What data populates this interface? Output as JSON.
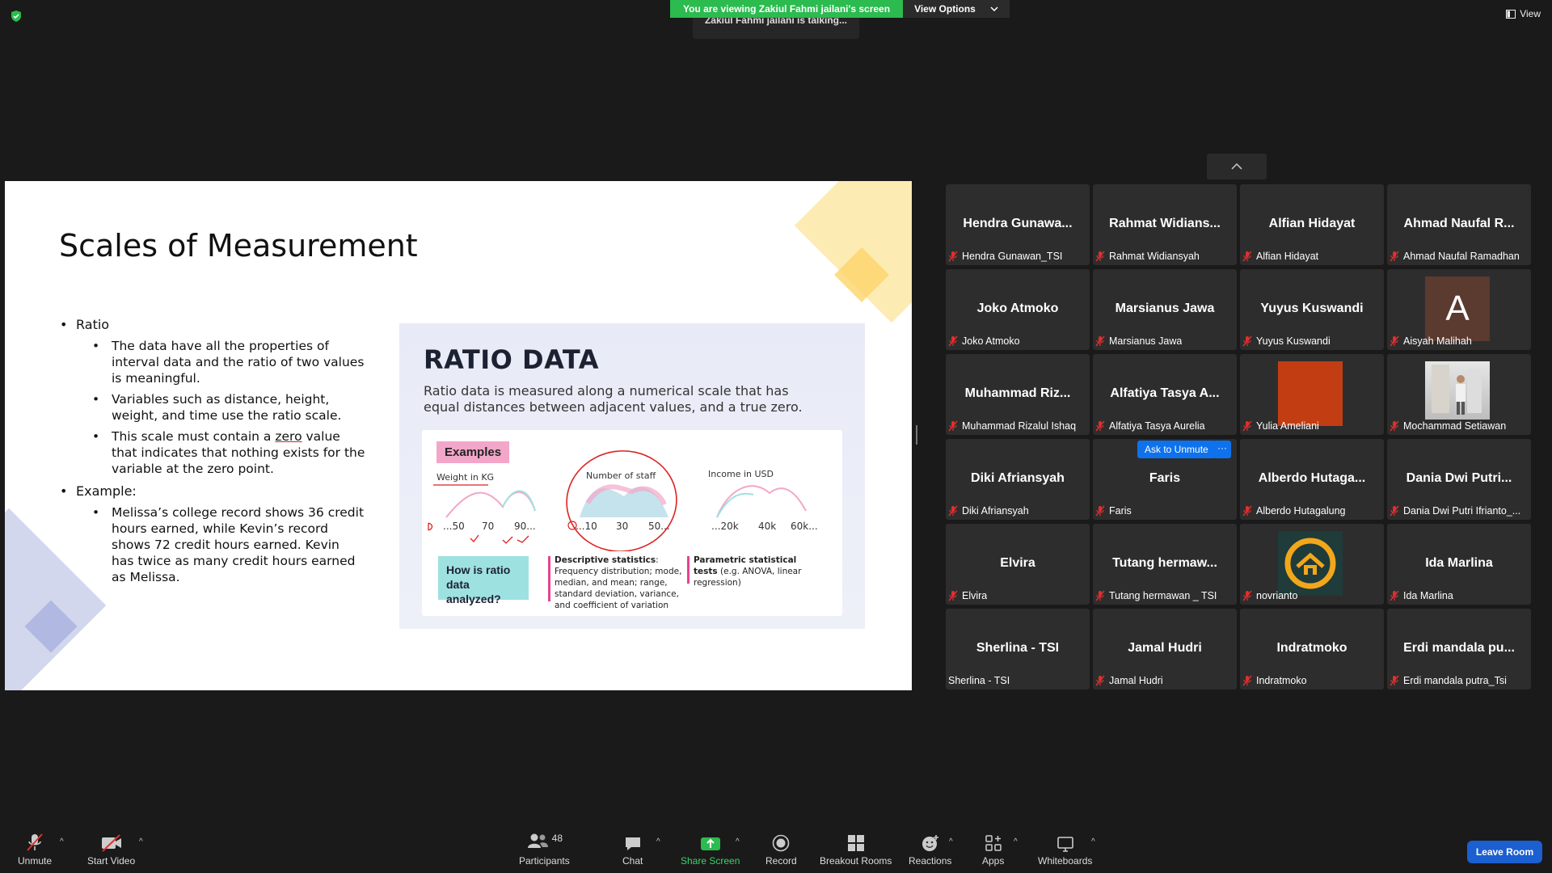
{
  "top": {
    "banner_text": "You are viewing Zakiul Fahmi jailani's screen",
    "view_options": "View Options",
    "talking": "Zakiul Fahmi jailani is talking...",
    "view_label": "View"
  },
  "slide": {
    "title": "Scales of Measurement",
    "bullet1": "Ratio",
    "sub1": "The data have all the properties of interval data and the ratio of two values is meaningful.",
    "sub2": "Variables such as distance, height, weight, and time use the ratio scale.",
    "sub3a": "This scale must contain a ",
    "sub3b": "zero",
    "sub3c": " value that indicates that nothing exists for the variable at the zero point.",
    "bullet2": "Example:",
    "sub4": "Melissa’s college record shows 36 credit hours earned, while Kevin’s record shows 72 credit hours earned. Kevin has twice as many credit hours earned as Melissa.",
    "panel": {
      "title": "RATIO DATA",
      "desc": "Ratio data is measured along a numerical scale that has equal distances between adjacent values, and a true zero.",
      "examples": "Examples",
      "weight_label": "Weight in KG",
      "staff_label": "Number of staff",
      "income_label": "Income in USD",
      "weight_ticks": [
        "...50",
        "70",
        "90..."
      ],
      "staff_ticks": [
        "...10",
        "30",
        "50..."
      ],
      "income_ticks": [
        "...20k",
        "40k",
        "60k..."
      ],
      "how": "How is ratio data analyzed?",
      "desc_stats_bold": "Descriptive statistics",
      "desc_stats": ": Frequency distribution; mode, median, and mean; range, standard deviation, variance, and coefficient of variation",
      "param_bold": "Parametric statistical tests",
      "param": " (e.g. ANOVA, linear regression)"
    }
  },
  "participants": [
    {
      "name": "Hendra  Gunawa...",
      "label": "Hendra Gunawan_TSI"
    },
    {
      "name": "Rahmat  Widians...",
      "label": "Rahmat Widiansyah"
    },
    {
      "name": "Alfian Hidayat",
      "label": "Alfian Hidayat"
    },
    {
      "name": "Ahmad Naufal R...",
      "label": "Ahmad Naufal Ramadhan"
    },
    {
      "name": "Joko Atmoko",
      "label": "Joko Atmoko"
    },
    {
      "name": "Marsianus Jawa",
      "label": "Marsianus Jawa"
    },
    {
      "name": "Yuyus Kuswandi",
      "label": "Yuyus Kuswandi"
    },
    {
      "name": "A",
      "label": "Aisyah Malihah"
    },
    {
      "name": "Muhammad  Riz...",
      "label": "Muhammad Rizalul Ishaq"
    },
    {
      "name": "Alfatiya Tasya A...",
      "label": "Alfatiya Tasya Aurelia"
    },
    {
      "name": "",
      "label": "Yulia Ameliani"
    },
    {
      "name": "",
      "label": "Mochammad Setiawan"
    },
    {
      "name": "Diki Afriansyah",
      "label": "Diki Afriansyah"
    },
    {
      "name": "Faris",
      "label": "Faris"
    },
    {
      "name": "Alberdo  Hutaga...",
      "label": "Alberdo Hutagalung"
    },
    {
      "name": "Dania  Dwi  Putri...",
      "label": "Dania Dwi Putri Ifrianto_..."
    },
    {
      "name": "Elvira",
      "label": "Elvira"
    },
    {
      "name": "Tutang  hermaw...",
      "label": "Tutang hermawan _ TSI"
    },
    {
      "name": "",
      "label": "novrianto"
    },
    {
      "name": "Ida Marlina",
      "label": "Ida Marlina"
    },
    {
      "name": "Sherlina - TSI",
      "label": "Sherlina - TSI"
    },
    {
      "name": "Jamal Hudri",
      "label": "Jamal Hudri"
    },
    {
      "name": "Indratmoko",
      "label": "Indratmoko"
    },
    {
      "name": "Erdi  mandala  pu...",
      "label": "Erdi mandala putra_Tsi"
    }
  ],
  "ask_unmute": "Ask to Unmute",
  "ask_more": "···",
  "toolbar": {
    "unmute": "Unmute",
    "start_video": "Start Video",
    "participants": "Participants",
    "participants_count": "48",
    "chat": "Chat",
    "share_screen": "Share Screen",
    "record": "Record",
    "breakout_rooms": "Breakout Rooms",
    "reactions": "Reactions",
    "apps": "Apps",
    "whiteboards": "Whiteboards",
    "leave_room": "Leave Room"
  },
  "colors": {
    "banner_green": "#2bbb4f",
    "leave_blue": "#1b5fd1",
    "share_green": "#3ad46a",
    "mute_red": "#e02f2f"
  }
}
